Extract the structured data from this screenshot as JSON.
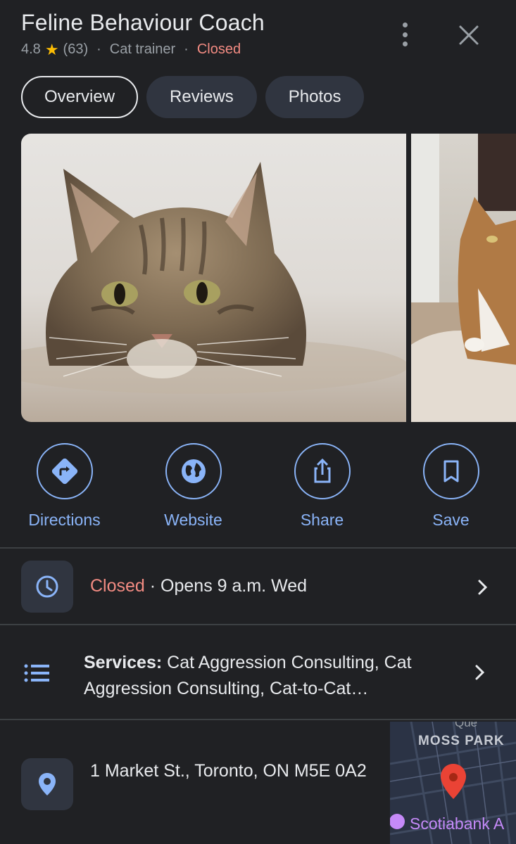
{
  "header": {
    "title": "Feline Behaviour Coach",
    "rating": "4.8",
    "review_count": "(63)",
    "category": "Cat trainer",
    "status": "Closed"
  },
  "tabs": [
    {
      "label": "Overview",
      "active": true
    },
    {
      "label": "Reviews",
      "active": false
    },
    {
      "label": "Photos",
      "active": false
    }
  ],
  "photos": [
    {
      "icon": "tabby-cat-photo"
    },
    {
      "icon": "calico-cat-photo"
    }
  ],
  "actions": [
    {
      "label": "Directions",
      "icon": "directions-icon"
    },
    {
      "label": "Website",
      "icon": "globe-icon"
    },
    {
      "label": "Share",
      "icon": "share-icon"
    },
    {
      "label": "Save",
      "icon": "bookmark-icon"
    }
  ],
  "hours": {
    "status": "Closed",
    "detail": " · Opens 9 a.m. Wed"
  },
  "services": {
    "label": "Services:",
    "text": " Cat Aggression Consulting, Cat Aggression Consulting, Cat-to-Cat…"
  },
  "address": {
    "text": "1 Market St., Toronto, ON M5E 0A2",
    "map_labels": [
      "Que",
      "MOSS PARK",
      "Scotiabank A"
    ]
  },
  "colors": {
    "background": "#202124",
    "accent": "#8ab4f8",
    "closed": "#f28b82",
    "star": "#fbbc04"
  }
}
